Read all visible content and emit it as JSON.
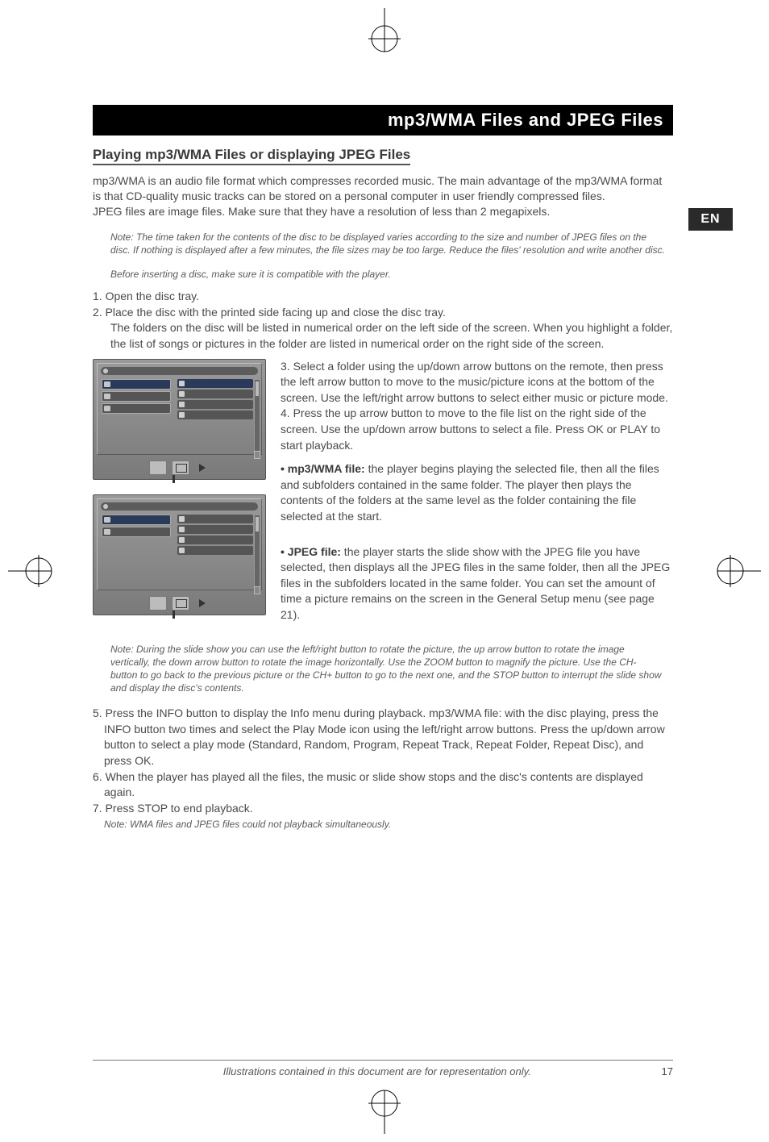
{
  "lang_tab": "EN",
  "page_number": "17",
  "footer_text": "Illustrations contained in this document are for representation only.",
  "banner_title": "mp3/WMA Files and JPEG Files",
  "subheading": "Playing mp3/WMA Files or displaying JPEG Files",
  "intro": "mp3/WMA is an audio file format which compresses recorded music. The main advantage of the mp3/WMA format is that CD-quality music tracks can be stored on a personal computer in user friendly compressed files.\nJPEG files are image files. Make sure that they have a resolution of less than 2 megapixels.",
  "note1": "Note: The time taken for the contents of the disc to be displayed varies according to the size and number of JPEG files on the disc. If nothing is displayed after a few minutes, the file sizes may be too large. Reduce the files' resolution and write another disc.",
  "note2": "Before inserting a disc, make sure it is compatible with the player.",
  "step1": "1. Open the disc tray.",
  "step2": "2. Place the disc with the printed side facing up and close the disc tray.",
  "step2_detail": "The folders on the disc will be listed in numerical order on the left side of the screen. When you highlight a folder, the list of songs or pictures in the folder are listed in numerical order on the right side of the screen.",
  "step3": "3. Select a folder using the up/down arrow buttons on the remote, then press the left arrow button to move to the music/picture icons at the bottom of the screen. Use the left/right arrow buttons to select either music or picture mode.",
  "step4": "4. Press the up arrow button to move to the file list on the right side of the screen. Use the up/down arrow buttons to select a file. Press OK or PLAY to start playback.",
  "bullet_mp3_label": "• mp3/WMA file:",
  "bullet_mp3_text": " the player begins playing the selected file, then all the files and subfolders contained in the same folder. The player then plays the contents of the folders at the same level as the folder containing the file selected at the start.",
  "bullet_jpeg_label": "• JPEG file:",
  "bullet_jpeg_text": " the player starts the slide show with the JPEG file you have selected, then displays all the JPEG files in the same folder, then all the JPEG files in the subfolders located in the same folder. You can set the amount of time a picture remains on the screen in the General Setup menu (see page 21).",
  "note3": "Note: During the slide show you can use the left/right button to rotate the picture, the up arrow button to rotate the image vertically, the down arrow button to rotate the image horizontally. Use the ZOOM button to magnify the picture. Use the CH- button to go back to the previous picture or the CH+ button to go to the next one, and the STOP button to interrupt the slide show and display the disc's contents.",
  "step5": "5. Press the INFO button to display the Info menu during playback. mp3/WMA file: with the disc playing, press the INFO button two times and select the Play Mode icon using the left/right arrow buttons. Press the up/down arrow button to select a play mode (Standard, Random, Program, Repeat Track, Repeat Folder, Repeat Disc), and press OK.",
  "step6": "6. When the player has played all the files, the music or slide show stops and the disc's contents are displayed again.",
  "step7": "7. Press STOP to end playback.",
  "note4": "Note: WMA files and JPEG files could not playback simultaneously."
}
